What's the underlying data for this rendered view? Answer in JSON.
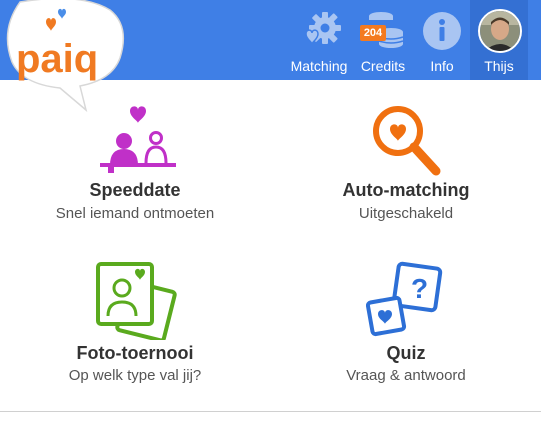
{
  "header": {
    "brand_logo_text": "paiq",
    "nav": [
      {
        "id": "matching",
        "label": "Matching",
        "icon": "gear-heart-icon"
      },
      {
        "id": "credits",
        "label": "Credits",
        "icon": "coins-icon",
        "badge": "204"
      },
      {
        "id": "info",
        "label": "Info",
        "icon": "info-icon"
      },
      {
        "id": "profile",
        "label": "Thijs",
        "icon": "avatar"
      }
    ]
  },
  "tiles": [
    {
      "id": "speeddate",
      "title": "Speeddate",
      "subtitle": "Snel iemand ontmoeten",
      "icon": "speeddate-icon",
      "color": "#c030c8"
    },
    {
      "id": "automatching",
      "title": "Auto-matching",
      "subtitle": "Uitgeschakeld",
      "icon": "magnifier-heart-icon",
      "color": "#f07010"
    },
    {
      "id": "fototoernooi",
      "title": "Foto-toernooi",
      "subtitle": "Op welk type val jij?",
      "icon": "photo-cards-icon",
      "color": "#5aaa1e"
    },
    {
      "id": "quiz",
      "title": "Quiz",
      "subtitle": "Vraag & antwoord",
      "icon": "quiz-cards-icon",
      "color": "#2d6fd6"
    }
  ],
  "colors": {
    "topbar": "#3f7fe6",
    "logo_orange": "#f07a22",
    "logo_blue": "#4a8ee8"
  }
}
